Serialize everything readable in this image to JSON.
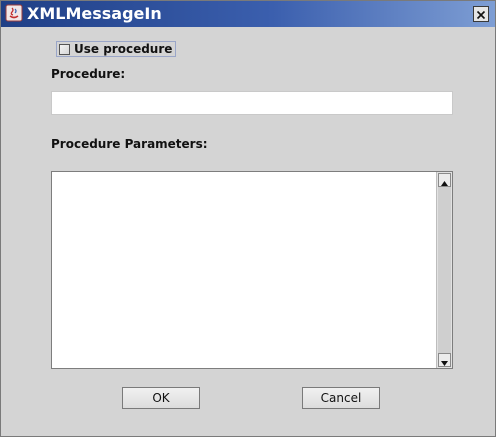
{
  "window": {
    "title": "XMLMessageIn",
    "icon": "java-app-icon",
    "close_icon": "close-icon"
  },
  "form": {
    "use_procedure": {
      "label": "Use procedure",
      "checked": false
    },
    "procedure": {
      "label": "Procedure:",
      "value": "",
      "placeholder": ""
    },
    "procedure_parameters": {
      "label": "Procedure Parameters:",
      "value": ""
    }
  },
  "buttons": {
    "ok": "OK",
    "cancel": "Cancel"
  },
  "colors": {
    "title_bar_start": "#1f3f86",
    "title_bar_end": "#7e9ed4",
    "background": "#d4d4d4"
  }
}
